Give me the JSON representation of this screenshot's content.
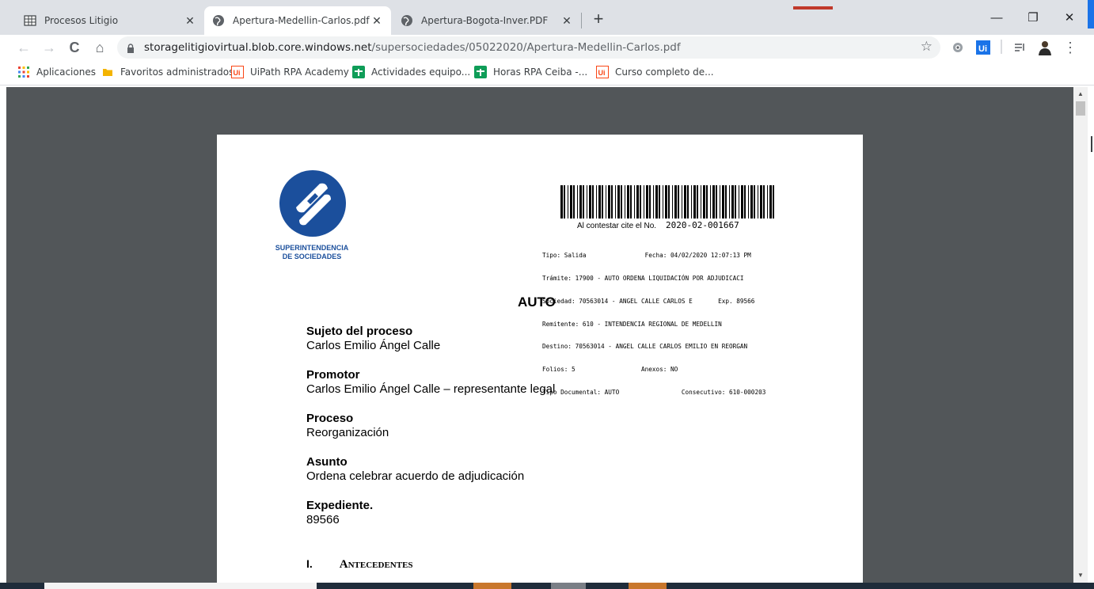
{
  "tabs": [
    {
      "label": "Procesos Litigio",
      "icon": "spreadsheet-icon",
      "active": false
    },
    {
      "label": "Apertura-Medellin-Carlos.pdf",
      "icon": "globe-icon",
      "active": true
    },
    {
      "label": "Apertura-Bogota-Inver.PDF",
      "icon": "globe-icon",
      "active": false
    }
  ],
  "tab_close_glyph": "✕",
  "new_tab_glyph": "+",
  "window_controls": {
    "minimize": "—",
    "restore": "❐",
    "close": "✕"
  },
  "toolbar": {
    "back": "←",
    "forward": "→",
    "reload": "C",
    "home": "⌂",
    "url_host": "storagelitigiovirtual.blob.core.windows.net",
    "url_path": "/supersociedades/05022020/Apertura-Medellin-Carlos.pdf",
    "star": "☆",
    "menu": "⋮"
  },
  "bookmarks": [
    {
      "label": "Aplicaciones",
      "icon": "apps-grid-icon"
    },
    {
      "label": "Favoritos administrados",
      "icon": "folder-icon"
    },
    {
      "label": "UiPath RPA Academy",
      "icon": "uipath-icon"
    },
    {
      "label": "Actividades equipo...",
      "icon": "sheets-icon"
    },
    {
      "label": "Horas RPA Ceiba -...",
      "icon": "sheets-icon"
    },
    {
      "label": "Curso completo de...",
      "icon": "uipath-icon"
    }
  ],
  "document": {
    "logo_text_line1": "SUPERINTENDENCIA",
    "logo_text_line2": "DE SOCIEDADES",
    "cite_label": "Al contestar cite el No.",
    "cite_number": "2020-02-001667",
    "meta_lines": [
      "Tipo: Salida                Fecha: 04/02/2020 12:07:13 PM",
      "Trámite: 17900 - AUTO ORDENA LIQUIDACIÓN POR ADJUDICACI",
      "Sociedad: 70563014 - ANGEL CALLE CARLOS E       Exp. 89566",
      "Remitente: 610 - INTENDENCIA REGIONAL DE MEDELLIN",
      "Destino: 70563014 - ANGEL CALLE CARLOS EMILIO EN REORGAN",
      "Folios: 5                  Anexos: NO",
      "Tipo Documental: AUTO                 Consecutivo: 610-000203"
    ],
    "title": "AUTO",
    "fields": [
      {
        "label": "Sujeto del proceso",
        "value": "Carlos Emilio Ángel Calle"
      },
      {
        "label": "Promotor",
        "value": "Carlos Emilio Ángel Calle – representante legal"
      },
      {
        "label": "Proceso",
        "value": "Reorganización"
      },
      {
        "label": "Asunto",
        "value": "Ordena celebrar acuerdo de adjudicación"
      },
      {
        "label": "Expediente.",
        "value": "89566"
      }
    ],
    "section_number": "I.",
    "section_title": "Antecedentes"
  },
  "colors": {
    "tabstrip": "#dee1e6",
    "viewer_bg": "#525659",
    "logo_blue": "#1b4f9c",
    "accent_blue": "#1a73e8"
  }
}
